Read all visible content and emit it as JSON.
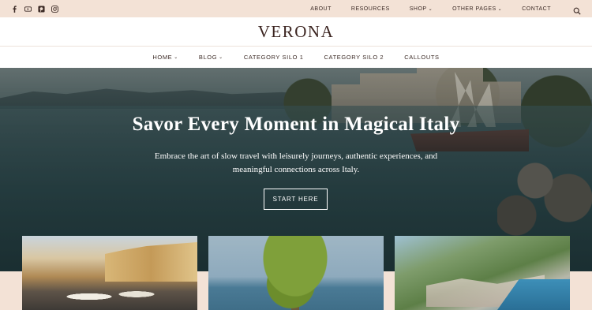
{
  "colors": {
    "topbar_bg": "#f3e2d6",
    "text_dark": "#3b2a25",
    "logo": "#3b2420",
    "white": "#ffffff"
  },
  "social": [
    {
      "icon": "facebook-icon"
    },
    {
      "icon": "youtube-icon"
    },
    {
      "icon": "pinterest-icon"
    },
    {
      "icon": "instagram-icon"
    }
  ],
  "utility_nav": {
    "items": [
      {
        "label": "ABOUT",
        "has_dropdown": false
      },
      {
        "label": "RESOURCES",
        "has_dropdown": false
      },
      {
        "label": "SHOP",
        "has_dropdown": true
      },
      {
        "label": "OTHER PAGES",
        "has_dropdown": true
      },
      {
        "label": "CONTACT",
        "has_dropdown": false
      }
    ],
    "search_icon": "search-icon"
  },
  "logo": {
    "text": "VERONA"
  },
  "main_nav": {
    "items": [
      {
        "label": "HOME",
        "has_dropdown": true
      },
      {
        "label": "BLOG",
        "has_dropdown": true
      },
      {
        "label": "CATEGORY SILO 1",
        "has_dropdown": false
      },
      {
        "label": "CATEGORY SILO 2",
        "has_dropdown": false
      },
      {
        "label": "CALLOUTS",
        "has_dropdown": false
      }
    ]
  },
  "hero": {
    "title": "Savor Every Moment in Magical Italy",
    "subtitle": "Embrace the art of slow travel with leisurely journeys, authentic experiences, and meaningful connections across Italy.",
    "button_label": "START HERE"
  },
  "chevron": "⌄"
}
